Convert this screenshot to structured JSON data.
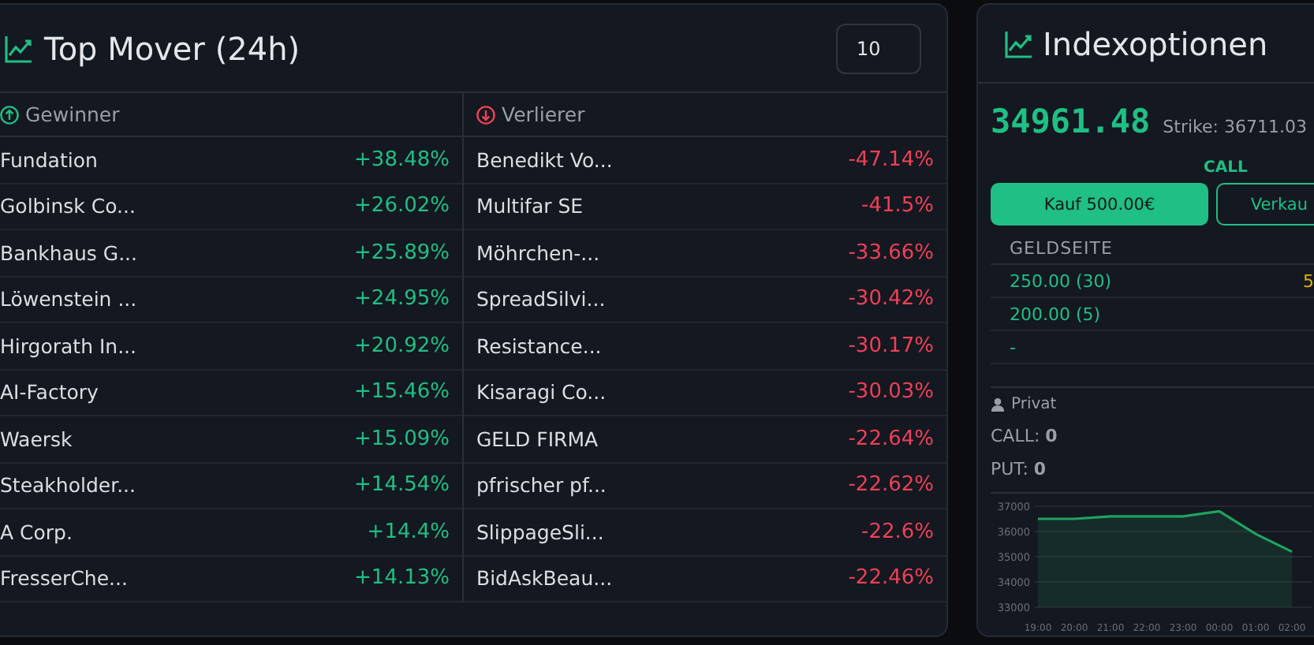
{
  "top_mover": {
    "title": "Top Mover (24h)",
    "count_field": {
      "value": "10"
    },
    "winners": {
      "header": "Gewinner",
      "rows": [
        {
          "name": "Fundation",
          "change": "+38.48%"
        },
        {
          "name": "Golbinsk Co...",
          "change": "+26.02%"
        },
        {
          "name": "Bankhaus G...",
          "change": "+25.89%"
        },
        {
          "name": "Löwenstein ...",
          "change": "+24.95%"
        },
        {
          "name": "Hirgorath In...",
          "change": "+20.92%"
        },
        {
          "name": "AI-Factory",
          "change": "+15.46%"
        },
        {
          "name": "Waersk",
          "change": "+15.09%"
        },
        {
          "name": "Steakholder...",
          "change": "+14.54%"
        },
        {
          "name": "A Corp.",
          "change": "+14.4%"
        },
        {
          "name": "FresserChe...",
          "change": "+14.13%"
        }
      ]
    },
    "losers": {
      "header": "Verlierer",
      "rows": [
        {
          "name": "Benedikt Vo...",
          "change": "-47.14%"
        },
        {
          "name": "Multifar SE",
          "change": "-41.5%"
        },
        {
          "name": "Möhrchen-...",
          "change": "-33.66%"
        },
        {
          "name": "SpreadSilvi...",
          "change": "-30.42%"
        },
        {
          "name": "Resistance...",
          "change": "-30.17%"
        },
        {
          "name": "Kisaragi Co...",
          "change": "-30.03%"
        },
        {
          "name": "GELD FIRMA",
          "change": "-22.64%"
        },
        {
          "name": "pfrischer pf...",
          "change": "-22.62%"
        },
        {
          "name": "SlippageSli...",
          "change": "-22.6%"
        },
        {
          "name": "BidAskBeau...",
          "change": "-22.46%"
        }
      ]
    }
  },
  "index_options": {
    "title": "Indexoptionen",
    "price": "34961.48",
    "strike": "Strike: 36711.03",
    "side_label": "CALL",
    "buttons": [
      {
        "label": "Kauf 500.00€",
        "kind": "buy"
      },
      {
        "label": "Verkau",
        "kind": "sell"
      }
    ],
    "book": {
      "header": "GELDSEITE",
      "rows": [
        {
          "bid": "250.00 (30)",
          "ask": "5"
        },
        {
          "bid": "200.00 (5)"
        },
        {
          "bid": "-"
        }
      ]
    },
    "private": {
      "label": "Privat",
      "call_label": "CALL:",
      "call_value": "0",
      "put_label": "PUT:",
      "put_value": "0"
    },
    "chart_data": {
      "type": "area",
      "x": [
        "19:00",
        "20:00",
        "21:00",
        "22:00",
        "23:00",
        "00:00",
        "01:00",
        "02:00"
      ],
      "grid": true,
      "series": [
        {
          "color": "#1fa35f",
          "values": [
            36500,
            36500,
            36600,
            36600,
            36600,
            36800,
            35900,
            35200
          ]
        }
      ],
      "ylim": [
        33000,
        37000
      ],
      "yticks": [
        33000,
        34000,
        35000,
        36000,
        37000
      ]
    }
  }
}
